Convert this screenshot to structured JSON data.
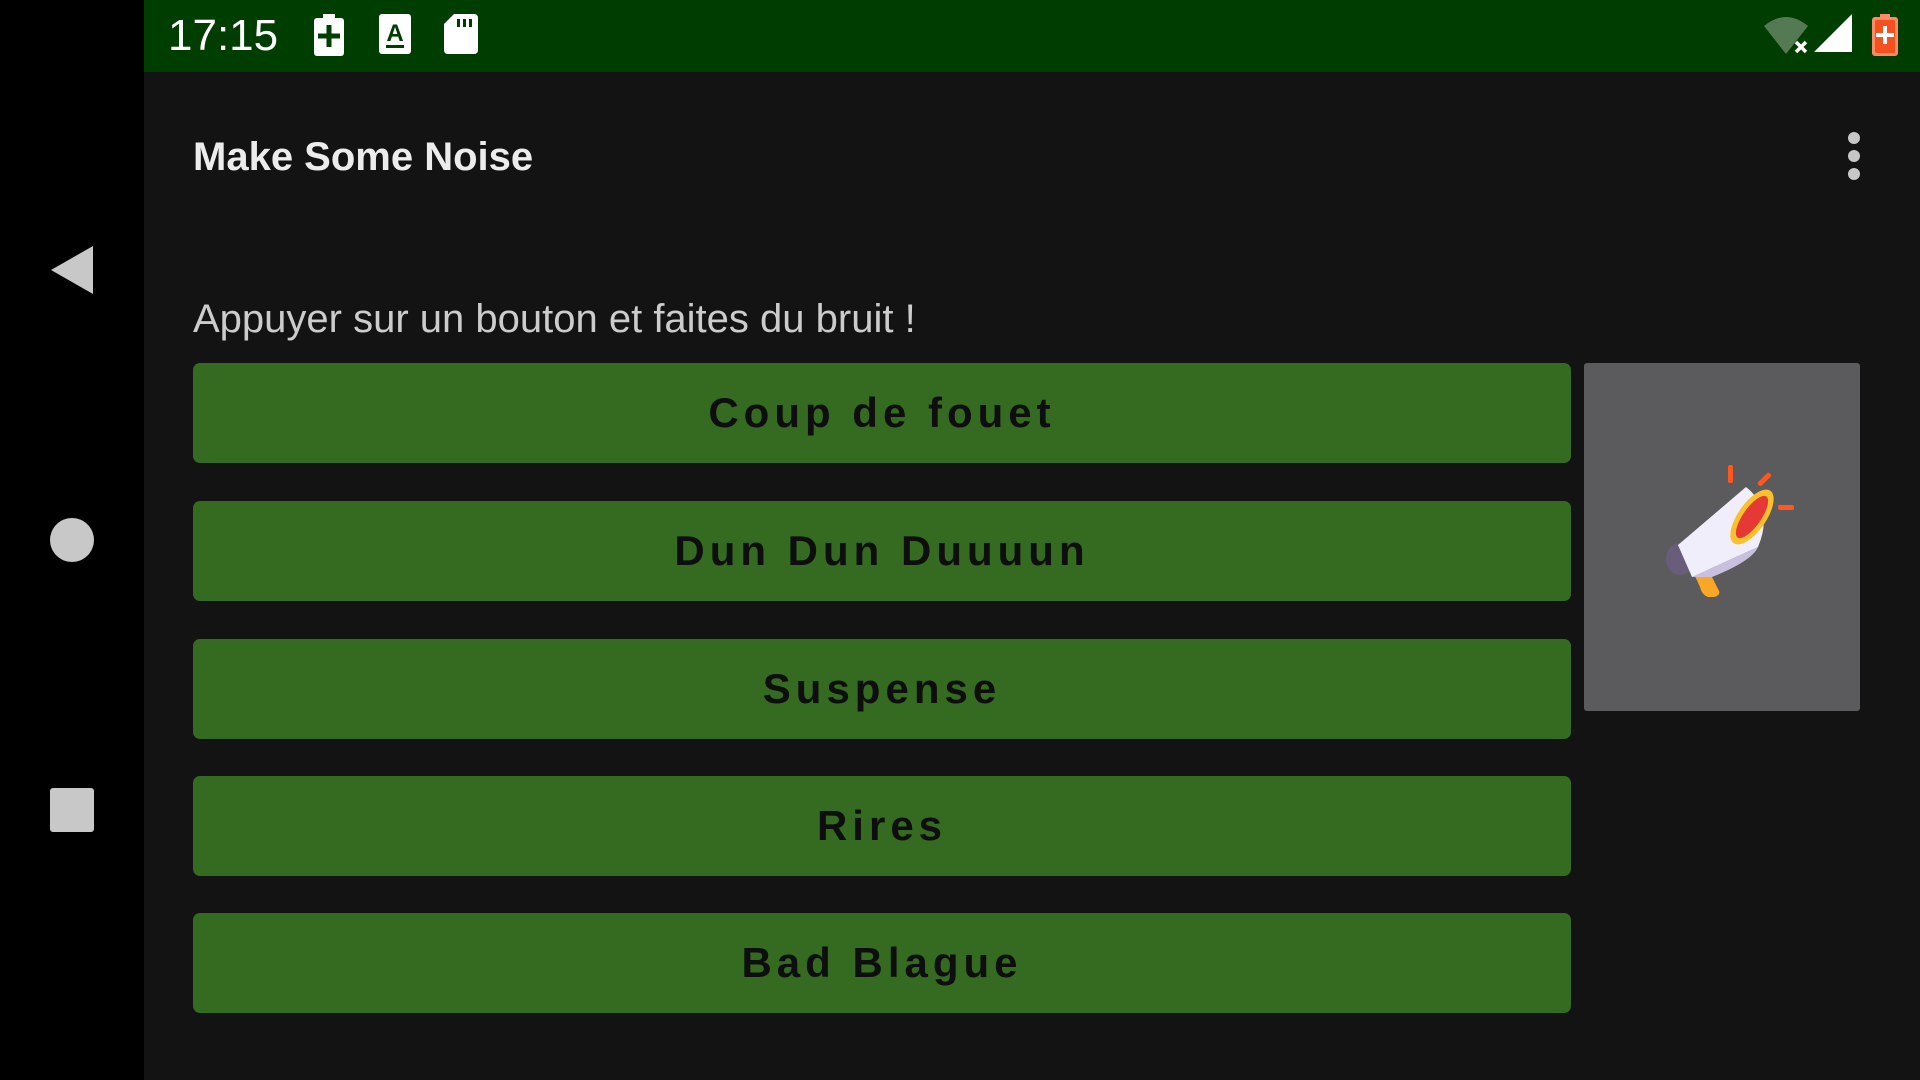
{
  "status_bar": {
    "time": "17:15",
    "icons": [
      "battery-saver-icon",
      "keyboard-icon",
      "sd-card-icon",
      "wifi-off-icon",
      "cell-signal-icon",
      "battery-charging-icon"
    ]
  },
  "app_bar": {
    "title": "Make Some Noise",
    "menu_icon": "more-vert-icon"
  },
  "main": {
    "instruction": "Appuyer sur un bouton et faites du bruit !",
    "buttons": [
      {
        "label": "Coup de fouet"
      },
      {
        "label": "Dun Dun Duuuun"
      },
      {
        "label": "Suspense"
      },
      {
        "label": "Rires"
      },
      {
        "label": "Bad Blague"
      }
    ],
    "image_icon": "megaphone-icon"
  },
  "navigation": {
    "icons": [
      "back-icon",
      "home-icon",
      "recents-icon"
    ]
  },
  "colors": {
    "status_bar": "#003d00",
    "background": "#131313",
    "button": "#356b20",
    "image_panel": "#5b5b5d"
  }
}
